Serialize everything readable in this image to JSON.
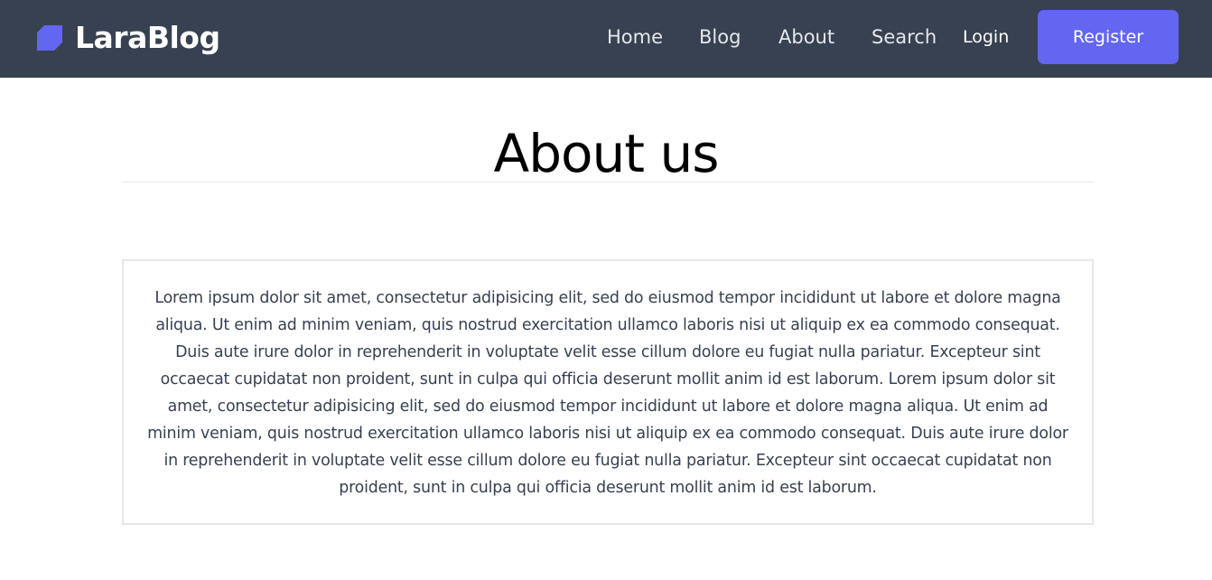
{
  "brand": {
    "name": "LaraBlog",
    "icon": "larablog-logo-icon",
    "icon_color": "#6366f1"
  },
  "nav": {
    "links": [
      "Home",
      "Blog",
      "About",
      "Search"
    ],
    "login_label": "Login",
    "register_label": "Register"
  },
  "colors": {
    "navbar_bg": "#374151",
    "accent": "#6366f1",
    "body_text": "#374151"
  },
  "page": {
    "title": "About us",
    "body": "Lorem ipsum dolor sit amet, consectetur adipisicing elit, sed do eiusmod tempor incididunt ut labore et dolore magna aliqua. Ut enim ad minim veniam, quis nostrud exercitation ullamco laboris nisi ut aliquip ex ea commodo consequat. Duis aute irure dolor in reprehenderit in voluptate velit esse cillum dolore eu fugiat nulla pariatur. Excepteur sint occaecat cupidatat non proident, sunt in culpa qui officia deserunt mollit anim id est laborum. Lorem ipsum dolor sit amet, consectetur adipisicing elit, sed do eiusmod tempor incididunt ut labore et dolore magna aliqua. Ut enim ad minim veniam, quis nostrud exercitation ullamco laboris nisi ut aliquip ex ea commodo consequat. Duis aute irure dolor in reprehenderit in voluptate velit esse cillum dolore eu fugiat nulla pariatur. Excepteur sint occaecat cupidatat non proident, sunt in culpa qui officia deserunt mollit anim id est laborum."
  }
}
